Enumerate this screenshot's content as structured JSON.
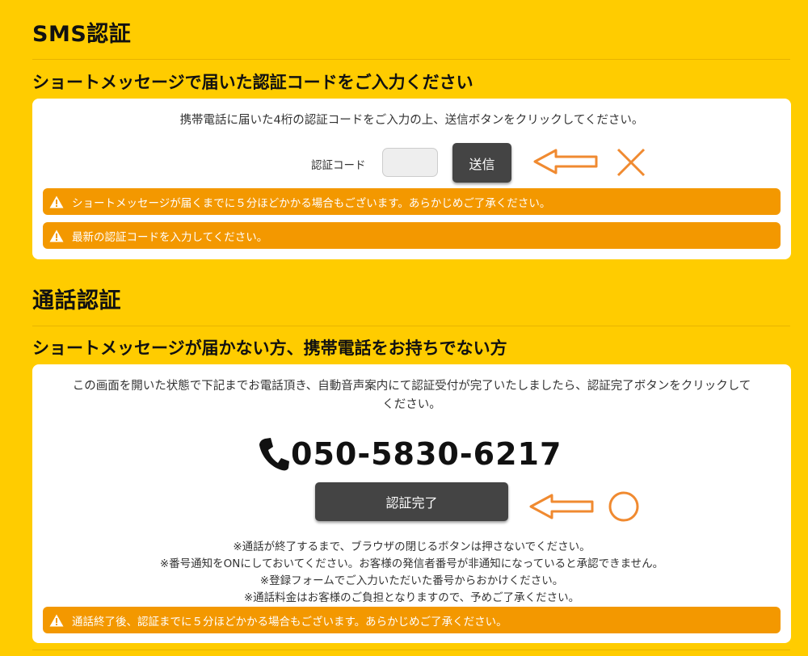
{
  "sms_section": {
    "title": "SMS認証",
    "subtitle": "ショートメッセージで届いた認証コードをご入力ください",
    "instruction": "携帯電話に届いた4桁の認証コードをご入力の上、送信ボタンをクリックしてください。",
    "code_label": "認証コード",
    "code_value": "",
    "send_button": "送信",
    "alerts": [
      "ショートメッセージが届くまでに５分ほどかかる場合もございます。あらかじめご了承ください。",
      "最新の認証コードを入力してください。"
    ]
  },
  "call_section": {
    "title": "通話認証",
    "subtitle": "ショートメッセージが届かない方、携帯電話をお持ちでない方",
    "instruction_line1": "この画面を開いた状態で下記までお電話頂き、自動音声案内にて認証受付が完了いたしましたら、認証完了ボタンをクリックして",
    "instruction_line2": "ください。",
    "phone_number": "050-5830-6217",
    "complete_button": "認証完了",
    "notes": [
      "※通話が終了するまで、ブラウザの閉じるボタンは押さないでください。",
      "※番号通知をONにしておいてください。お客様の発信者番号が非通知になっていると承認できません。",
      "※登録フォームでご入力いただいた番号からおかけください。",
      "※通話料金はお客様のご負担となりますので、予めご了承ください。"
    ],
    "alert": "通話終了後、認証までに５分ほどかかる場合もございます。あらかじめご了承ください。"
  },
  "colors": {
    "background": "#ffcc00",
    "alert": "#f39800",
    "button": "#444444",
    "annotation": "#f08a30"
  },
  "icons": {
    "warning": "warning-icon",
    "phone": "phone-icon",
    "arrow": "arrow-left-icon",
    "cross": "cross-mark-icon",
    "circle": "circle-mark-icon"
  }
}
